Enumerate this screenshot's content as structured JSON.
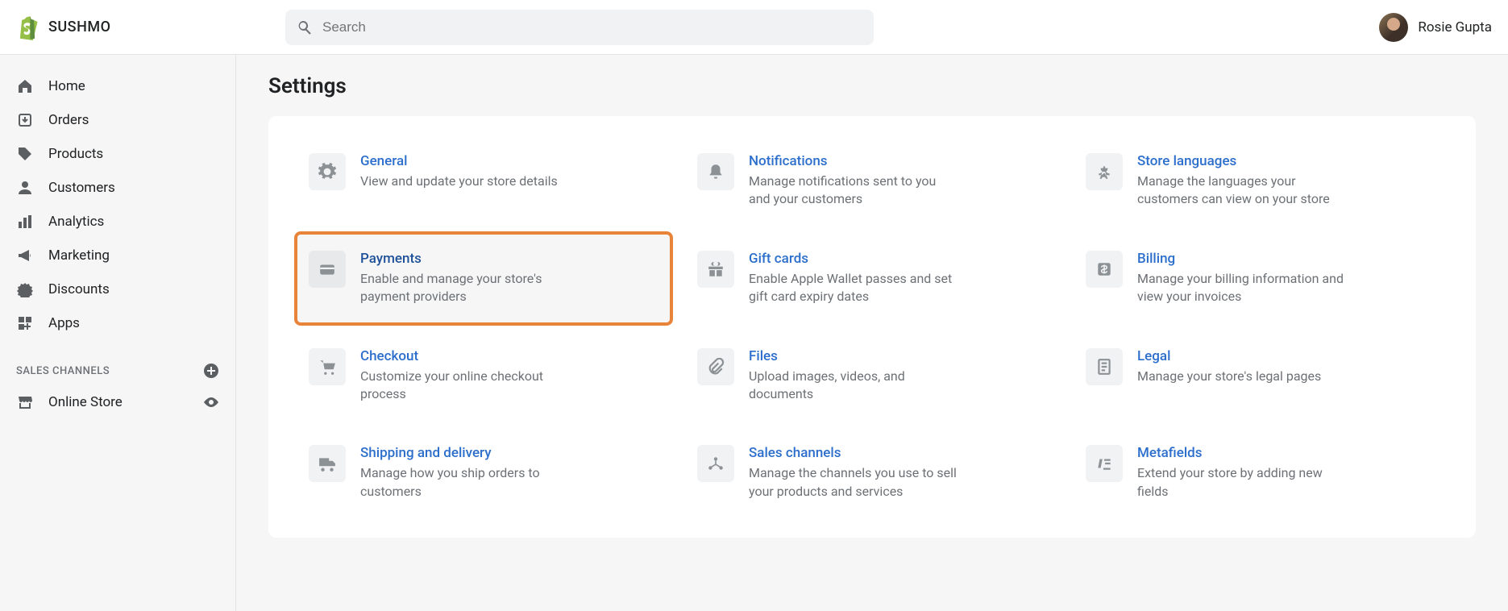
{
  "header": {
    "store_name": "SUSHMO",
    "search_placeholder": "Search",
    "user_name": "Rosie Gupta"
  },
  "sidebar": {
    "items": [
      {
        "icon": "home",
        "label": "Home"
      },
      {
        "icon": "orders",
        "label": "Orders"
      },
      {
        "icon": "products",
        "label": "Products"
      },
      {
        "icon": "customers",
        "label": "Customers"
      },
      {
        "icon": "analytics",
        "label": "Analytics"
      },
      {
        "icon": "marketing",
        "label": "Marketing"
      },
      {
        "icon": "discounts",
        "label": "Discounts"
      },
      {
        "icon": "apps",
        "label": "Apps"
      }
    ],
    "sales_channels_label": "SALES CHANNELS",
    "channels": [
      {
        "icon": "store",
        "label": "Online Store"
      }
    ]
  },
  "main": {
    "title": "Settings",
    "settings": [
      {
        "icon": "gear",
        "title": "General",
        "desc": "View and update your store details",
        "highlighted": false
      },
      {
        "icon": "bell",
        "title": "Notifications",
        "desc": "Manage notifications sent to you and your customers",
        "highlighted": false
      },
      {
        "icon": "languages",
        "title": "Store languages",
        "desc": "Manage the languages your customers can view on your store",
        "highlighted": false
      },
      {
        "icon": "card",
        "title": "Payments",
        "desc": "Enable and manage your store's payment providers",
        "highlighted": true
      },
      {
        "icon": "gift",
        "title": "Gift cards",
        "desc": "Enable Apple Wallet passes and set gift card expiry dates",
        "highlighted": false
      },
      {
        "icon": "dollar",
        "title": "Billing",
        "desc": "Manage your billing information and view your invoices",
        "highlighted": false
      },
      {
        "icon": "cart",
        "title": "Checkout",
        "desc": "Customize your online checkout process",
        "highlighted": false
      },
      {
        "icon": "clip",
        "title": "Files",
        "desc": "Upload images, videos, and documents",
        "highlighted": false
      },
      {
        "icon": "legal",
        "title": "Legal",
        "desc": "Manage your store's legal pages",
        "highlighted": false
      },
      {
        "icon": "truck",
        "title": "Shipping and delivery",
        "desc": "Manage how you ship orders to customers",
        "highlighted": false
      },
      {
        "icon": "channels",
        "title": "Sales channels",
        "desc": "Manage the channels you use to sell your products and services",
        "highlighted": false
      },
      {
        "icon": "meta",
        "title": "Metafields",
        "desc": "Extend your store by adding new fields",
        "highlighted": false
      }
    ]
  }
}
